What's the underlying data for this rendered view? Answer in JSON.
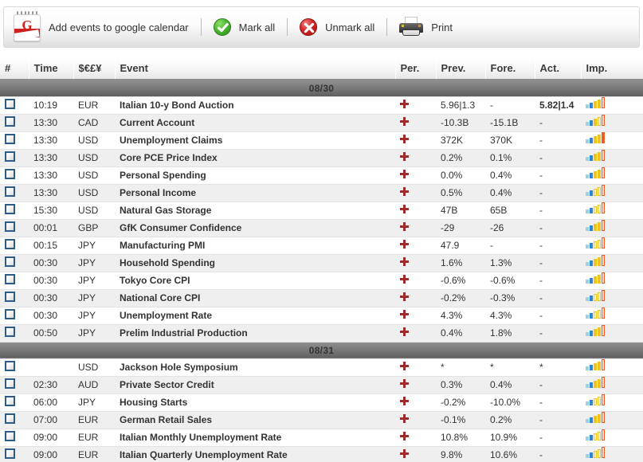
{
  "toolbar": {
    "google_calendar_label": "Add events to google calendar",
    "mark_all_label": "Mark all",
    "unmark_all_label": "Unmark all",
    "print_label": "Print",
    "google_letter": "G"
  },
  "table": {
    "headers": {
      "num": "#",
      "time": "Time",
      "currency": "$€£¥",
      "event": "Event",
      "per": "Per.",
      "prev": "Prev.",
      "fore": "Fore.",
      "act": "Act.",
      "imp": "Imp."
    },
    "groups": [
      {
        "date": "08/30",
        "rows": [
          {
            "time": "10:19",
            "currency": "EUR",
            "event": "Italian 10-y Bond Auction",
            "prev": "5.96|1.3",
            "fore": "-",
            "act": "5.82|1.4",
            "importance": 4
          },
          {
            "time": "13:30",
            "currency": "CAD",
            "event": "Current Account",
            "prev": "-10.3B",
            "fore": "-15.1B",
            "act": "-",
            "importance": 3
          },
          {
            "time": "13:30",
            "currency": "USD",
            "event": "Unemployment Claims",
            "prev": "372K",
            "fore": "370K",
            "act": "-",
            "importance": 5
          },
          {
            "time": "13:30",
            "currency": "USD",
            "event": "Core PCE Price Index",
            "prev": "0.2%",
            "fore": "0.1%",
            "act": "-",
            "importance": 4
          },
          {
            "time": "13:30",
            "currency": "USD",
            "event": "Personal Spending",
            "prev": "0.0%",
            "fore": "0.4%",
            "act": "-",
            "importance": 4
          },
          {
            "time": "13:30",
            "currency": "USD",
            "event": "Personal Income",
            "prev": "0.5%",
            "fore": "0.4%",
            "act": "-",
            "importance": 2
          },
          {
            "time": "15:30",
            "currency": "USD",
            "event": "Natural Gas Storage",
            "prev": "47B",
            "fore": "65B",
            "act": "-",
            "importance": 2
          },
          {
            "time": "00:01",
            "currency": "GBP",
            "event": "GfK Consumer Confidence",
            "prev": "-29",
            "fore": "-26",
            "act": "-",
            "importance": 4
          },
          {
            "time": "00:15",
            "currency": "JPY",
            "event": "Manufacturing PMI",
            "prev": "47.9",
            "fore": "-",
            "act": "-",
            "importance": 2
          },
          {
            "time": "00:30",
            "currency": "JPY",
            "event": "Household Spending",
            "prev": "1.6%",
            "fore": "1.3%",
            "act": "-",
            "importance": 4
          },
          {
            "time": "00:30",
            "currency": "JPY",
            "event": "Tokyo Core CPI",
            "prev": "-0.6%",
            "fore": "-0.6%",
            "act": "-",
            "importance": 4
          },
          {
            "time": "00:30",
            "currency": "JPY",
            "event": "National Core CPI",
            "prev": "-0.2%",
            "fore": "-0.3%",
            "act": "-",
            "importance": 2
          },
          {
            "time": "00:30",
            "currency": "JPY",
            "event": "Unemployment Rate",
            "prev": "4.3%",
            "fore": "4.3%",
            "act": "-",
            "importance": 2
          },
          {
            "time": "00:50",
            "currency": "JPY",
            "event": "Prelim Industrial Production",
            "prev": "0.4%",
            "fore": "1.8%",
            "act": "-",
            "importance": 4
          }
        ]
      },
      {
        "date": "08/31",
        "rows": [
          {
            "time": "",
            "currency": "USD",
            "event": "Jackson Hole Symposium",
            "prev": "*",
            "fore": "*",
            "act": "*",
            "importance": 4
          },
          {
            "time": "02:30",
            "currency": "AUD",
            "event": "Private Sector Credit",
            "prev": "0.3%",
            "fore": "0.4%",
            "act": "-",
            "importance": 4
          },
          {
            "time": "06:00",
            "currency": "JPY",
            "event": "Housing Starts",
            "prev": "-0.2%",
            "fore": "-10.0%",
            "act": "-",
            "importance": 2
          },
          {
            "time": "07:00",
            "currency": "EUR",
            "event": "German Retail Sales",
            "prev": "-0.1%",
            "fore": "0.2%",
            "act": "-",
            "importance": 4
          },
          {
            "time": "09:00",
            "currency": "EUR",
            "event": "Italian Monthly Unemployment Rate",
            "prev": "10.8%",
            "fore": "10.9%",
            "act": "-",
            "importance": 2
          },
          {
            "time": "09:00",
            "currency": "EUR",
            "event": "Italian Quarterly Unemployment Rate",
            "prev": "9.8%",
            "fore": "10.6%",
            "act": "-",
            "importance": 2
          }
        ]
      }
    ]
  },
  "colors": {
    "accent_orange": "#ef5b22",
    "accent_blue": "#2b86d4",
    "accent_yellow": "#f2c31e",
    "date_bar": "#7b7b7b",
    "plus_red": "#9e2b2b"
  }
}
